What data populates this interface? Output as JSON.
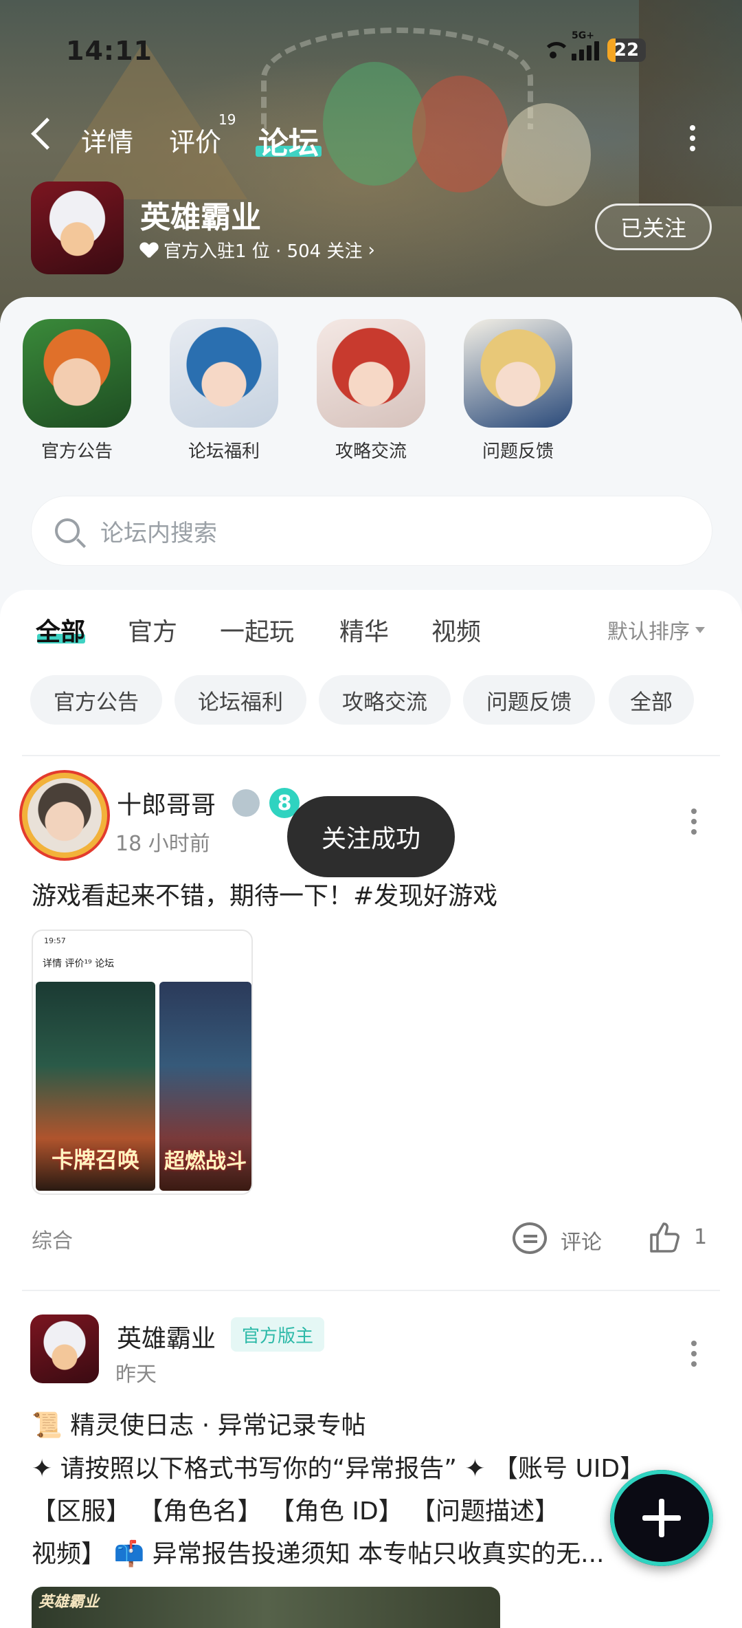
{
  "status": {
    "time": "14:11",
    "network": "5G+",
    "battery": "22"
  },
  "header": {
    "tabs": [
      {
        "label": "详情"
      },
      {
        "label": "评价",
        "badge": "19"
      },
      {
        "label": "论坛",
        "active": true
      }
    ]
  },
  "game": {
    "name": "英雄霸业",
    "stats": "官方入驻1 位 · 504 关注",
    "follow_label": "已关注"
  },
  "categories": [
    {
      "label": "官方公告",
      "color": "#3a8a3a"
    },
    {
      "label": "论坛福利",
      "color": "#2a6fb0"
    },
    {
      "label": "攻略交流",
      "color": "#c83a2e"
    },
    {
      "label": "问题反馈",
      "color": "#e8d9a0"
    }
  ],
  "search": {
    "placeholder": "论坛内搜索"
  },
  "feed_tabs": [
    {
      "label": "全部",
      "active": true
    },
    {
      "label": "官方"
    },
    {
      "label": "一起玩"
    },
    {
      "label": "精华"
    },
    {
      "label": "视频"
    }
  ],
  "sort_label": "默认排序",
  "chips": [
    "官方公告",
    "论坛福利",
    "攻略交流",
    "问题反馈",
    "全部"
  ],
  "toast": "关注成功",
  "post1": {
    "author": "十郎哥哥",
    "level": "8",
    "time": "18 小时前",
    "text": "游戏看起来不错，期待一下！#发现好游戏",
    "image": {
      "status_time": "19:57",
      "tabs": "详情  评价¹⁹  论坛",
      "card1_caption": "卡牌召唤",
      "card2_caption": "超燃战斗"
    },
    "category": "综合",
    "comment_label": "评论",
    "likes": "1"
  },
  "post2": {
    "author": "英雄霸业",
    "badge": "官方版主",
    "time": "昨天",
    "title": "📜 精灵使日志 · 异常记录专帖",
    "body_line1": "✦ 请按照以下格式书写你的“异常报告” ✦ 【账号 UID】",
    "body_line2": "【区服】 【角色名】 【角色 ID】 【问题描述】",
    "body_line3": "视频】 📫 异常报告投递须知 本专帖只收真实的无...",
    "image_label": "英雄霸业"
  },
  "colors": {
    "accent": "#3fd2c3",
    "official_badge": "#2cb9a8"
  }
}
